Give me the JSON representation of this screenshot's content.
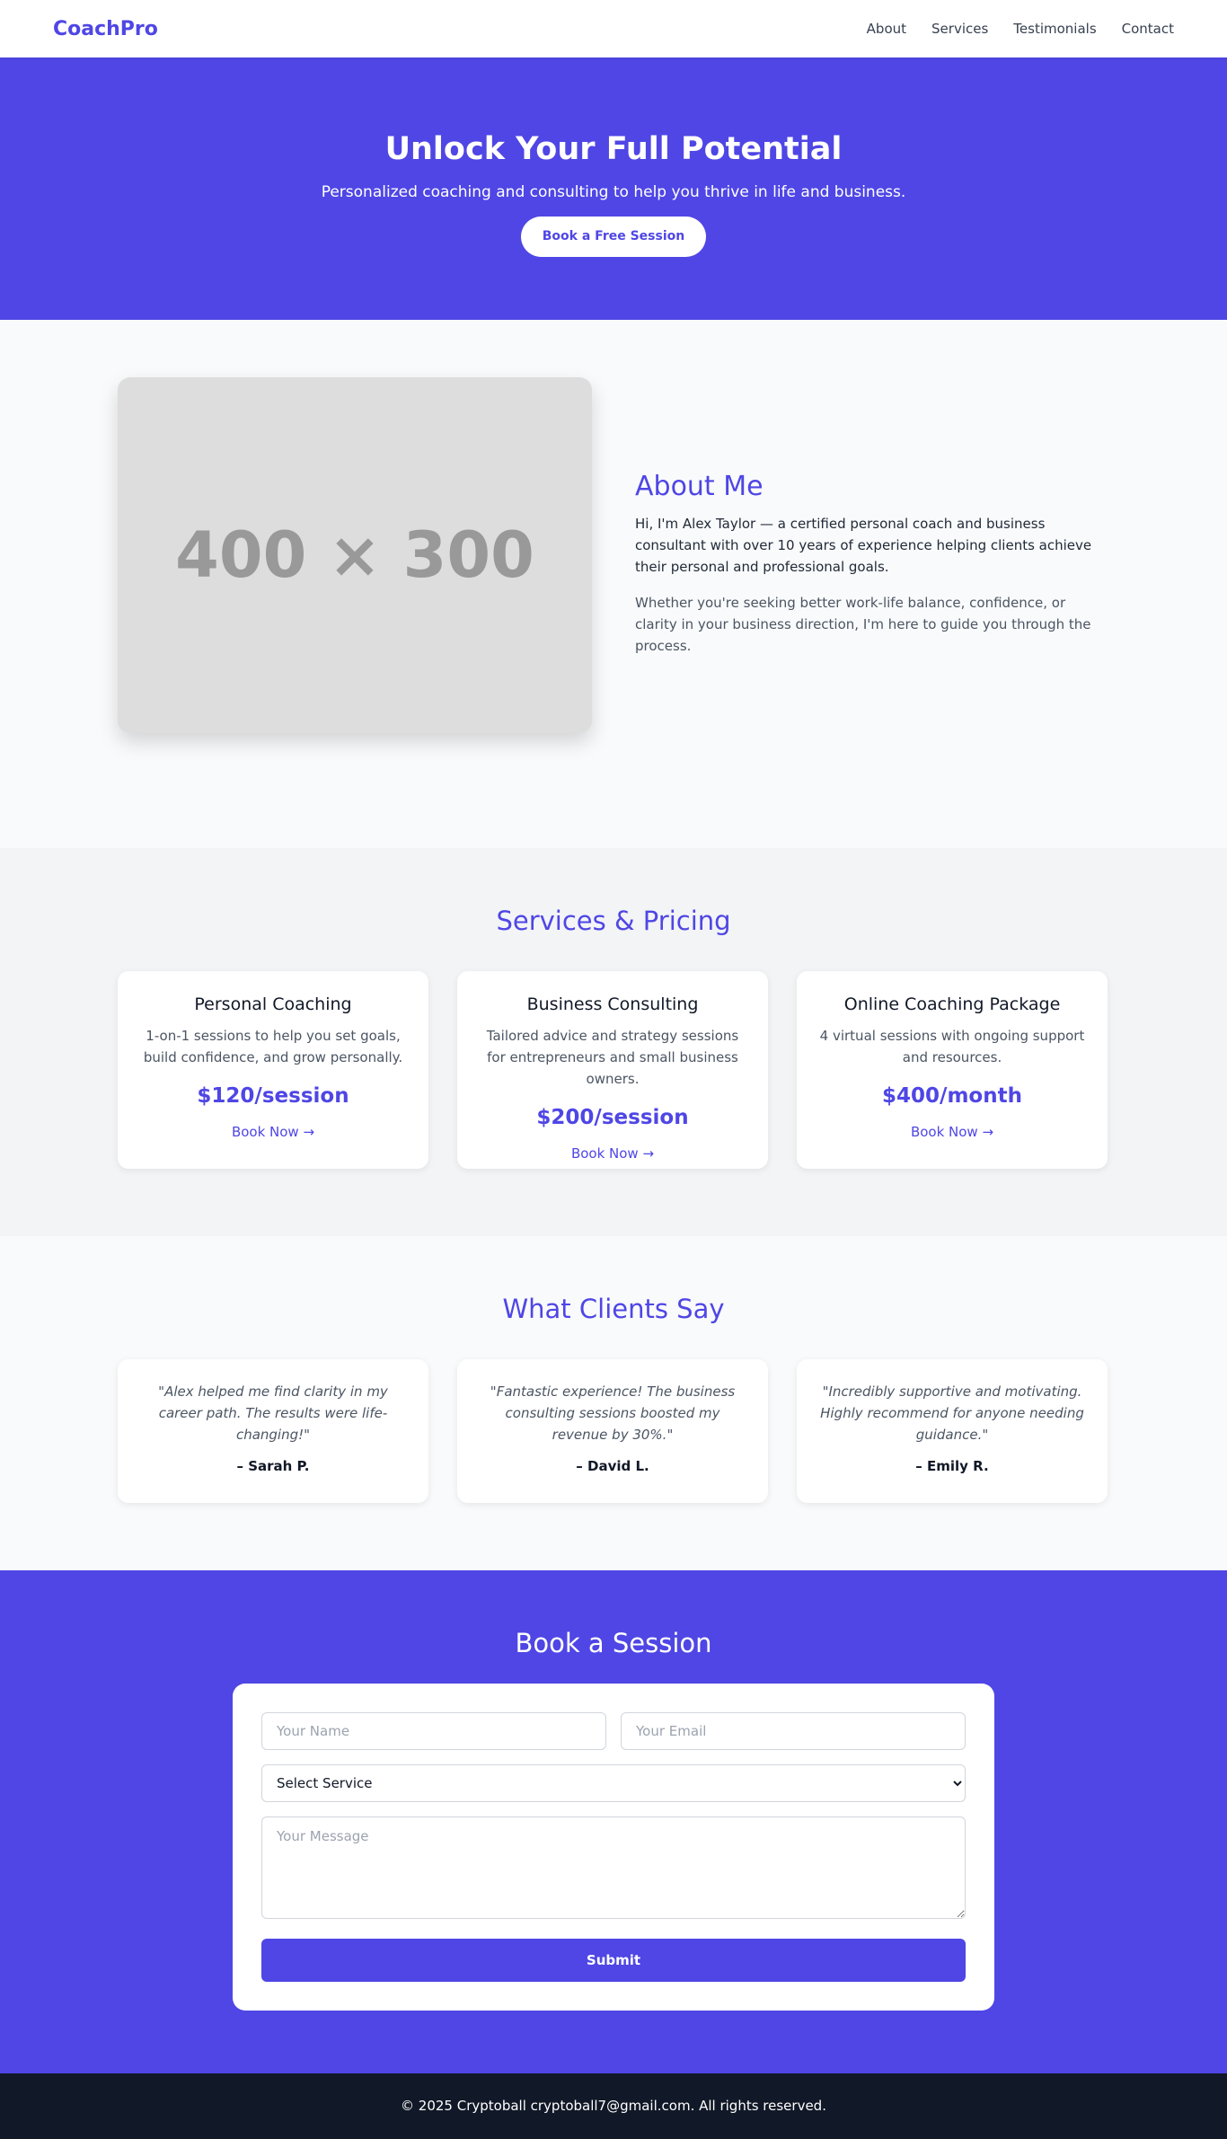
{
  "nav": {
    "logo": "CoachPro",
    "links": [
      "About",
      "Services",
      "Testimonials",
      "Contact"
    ]
  },
  "hero": {
    "title": "Unlock Your Full Potential",
    "subtitle": "Personalized coaching and consulting to help you thrive in life and business.",
    "cta": "Book a Free Session"
  },
  "about": {
    "image_placeholder": "400 × 300",
    "title": "About Me",
    "p1": "Hi, I'm Alex Taylor — a certified personal coach and business consultant with over 10 years of experience helping clients achieve their personal and professional goals.",
    "p2": "Whether you're seeking better work-life balance, confidence, or clarity in your business direction, I'm here to guide you through the process."
  },
  "services": {
    "title": "Services & Pricing",
    "items": [
      {
        "name": "Personal Coaching",
        "desc": "1-on-1 sessions to help you set goals, build confidence, and grow personally.",
        "price": "$120/session",
        "cta": "Book Now →"
      },
      {
        "name": "Business Consulting",
        "desc": "Tailored advice and strategy sessions for entrepreneurs and small business owners.",
        "price": "$200/session",
        "cta": "Book Now →"
      },
      {
        "name": "Online Coaching Package",
        "desc": "4 virtual sessions with ongoing support and resources.",
        "price": "$400/month",
        "cta": "Book Now →"
      }
    ]
  },
  "testimonials": {
    "title": "What Clients Say",
    "items": [
      {
        "quote": "\"Alex helped me find clarity in my career path. The results were life-changing!\"",
        "author": "– Sarah P."
      },
      {
        "quote": "\"Fantastic experience! The business consulting sessions boosted my revenue by 30%.\"",
        "author": "– David L."
      },
      {
        "quote": "\"Incredibly supportive and motivating. Highly recommend for anyone needing guidance.\"",
        "author": "– Emily R."
      }
    ]
  },
  "booking": {
    "title": "Book a Session",
    "name_placeholder": "Your Name",
    "email_placeholder": "Your Email",
    "select_value": "Select Service",
    "message_placeholder": "Your Message",
    "submit": "Submit"
  },
  "footer": {
    "text": "© 2025 Cryptoball cryptoball7@gmail.com. All rights reserved."
  },
  "colors": {
    "primary": "#4f46e5",
    "footer_bg": "#111827"
  }
}
